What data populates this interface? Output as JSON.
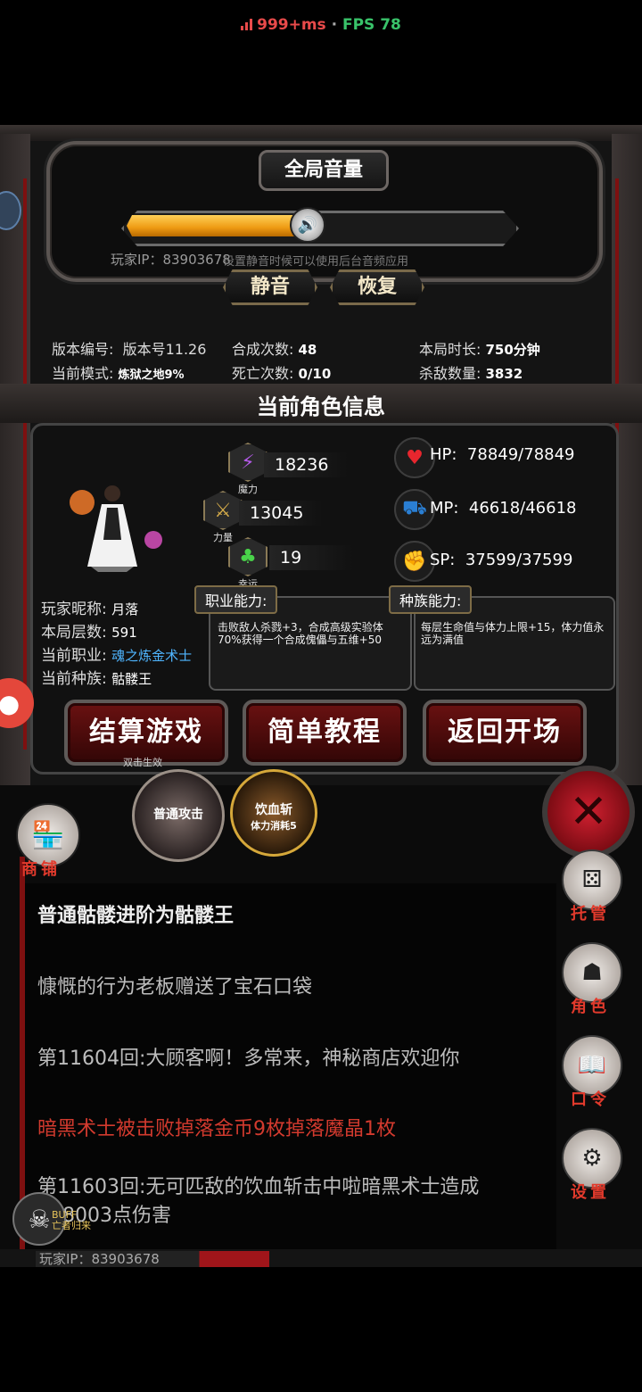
{
  "status_bar": {
    "latency": "999+ms",
    "separator": "·",
    "fps": "FPS 78"
  },
  "volume": {
    "title": "全局音量",
    "level_percent": 47,
    "player_ip_line": "玩家IP：83903678",
    "mute_hint": "设置静音时候可以使用后台音频应用",
    "mute_button": "静音",
    "restore_button": "恢复"
  },
  "stats": {
    "version_label": "版本编号:",
    "version_value": "版本号11.26",
    "merge_label": "合成次数:",
    "merge_value": "48",
    "duration_label": "本局时长:",
    "duration_value": "750分钟",
    "mode_label": "当前模式:",
    "mode_value": "炼狱之地9%",
    "death_label": "死亡次数:",
    "death_value": "0/10",
    "kill_label": "杀敌数量:",
    "kill_value": "3832"
  },
  "role": {
    "title": "当前角色信息",
    "attributes": [
      {
        "name": "魔力",
        "value": "18236",
        "icon": "lightning-icon",
        "color": "#9b3ad6"
      },
      {
        "name": "力量",
        "value": "13045",
        "icon": "sword-icon",
        "color": "#caa043"
      },
      {
        "name": "幸运",
        "value": "19",
        "icon": "clover-icon",
        "color": "#3fbf3f"
      }
    ],
    "resources": [
      {
        "label": "HP:",
        "value": "78849/78849",
        "icon": "heart-icon",
        "color": "#e8262e"
      },
      {
        "label": "MP:",
        "value": "46618/46618",
        "icon": "mana-icon",
        "color": "#2a7fd4"
      },
      {
        "label": "SP:",
        "value": "37599/37599",
        "icon": "stamina-icon",
        "color": "#e2b020"
      }
    ],
    "nickname_label": "玩家昵称:",
    "nickname": "月落",
    "floor_label": "本局层数:",
    "floor": "591",
    "class_label": "当前职业:",
    "class": "魂之炼金术士",
    "race_label": "当前种族:",
    "race": "骷髅王",
    "class_ability_title": "职业能力:",
    "class_ability_text": "击败敌人杀戮+3，合成高级实验体70%获得一个合成傀儡与五维+50",
    "race_ability_title": "种族能力:",
    "race_ability_text": "每层生命值与体力上限+15，体力值永远为满值"
  },
  "buttons": {
    "settle": "结算游戏",
    "settle_sub": "双击生效",
    "tutorial": "简单教程",
    "back": "返回开场"
  },
  "skills": [
    {
      "name": "普通攻击",
      "sub": ""
    },
    {
      "name": "饮血斩",
      "sub": "体力消耗5"
    }
  ],
  "side_menu": {
    "shop": "商铺",
    "auto": "托管",
    "role": "角色",
    "code": "口令",
    "settings": "设置"
  },
  "log": [
    {
      "text": "普通骷髅进阶为骷髅王",
      "color": "#f5f5f5"
    },
    {
      "text": "慷慨的行为老板赠送了宝石口袋",
      "color": "#bdbdbd"
    },
    {
      "text": "第11604回:大顾客啊！多常来，神秘商店欢迎你",
      "color": "#bdbdbd"
    },
    {
      "text": "暗黑术士被击败掉落金币9枚掉落魔晶1枚",
      "color": "#d23a2e"
    },
    {
      "text": "第11603回:无可匹敌的饮血斩击中啦暗黑术士造成",
      "color": "#bdbdbd"
    },
    {
      "text": "468003点伤害",
      "color": "#bdbdbd"
    }
  ],
  "buff": {
    "label": "BUFF",
    "name": "亡者归来"
  },
  "bottom_ip": "玩家IP：83903678"
}
